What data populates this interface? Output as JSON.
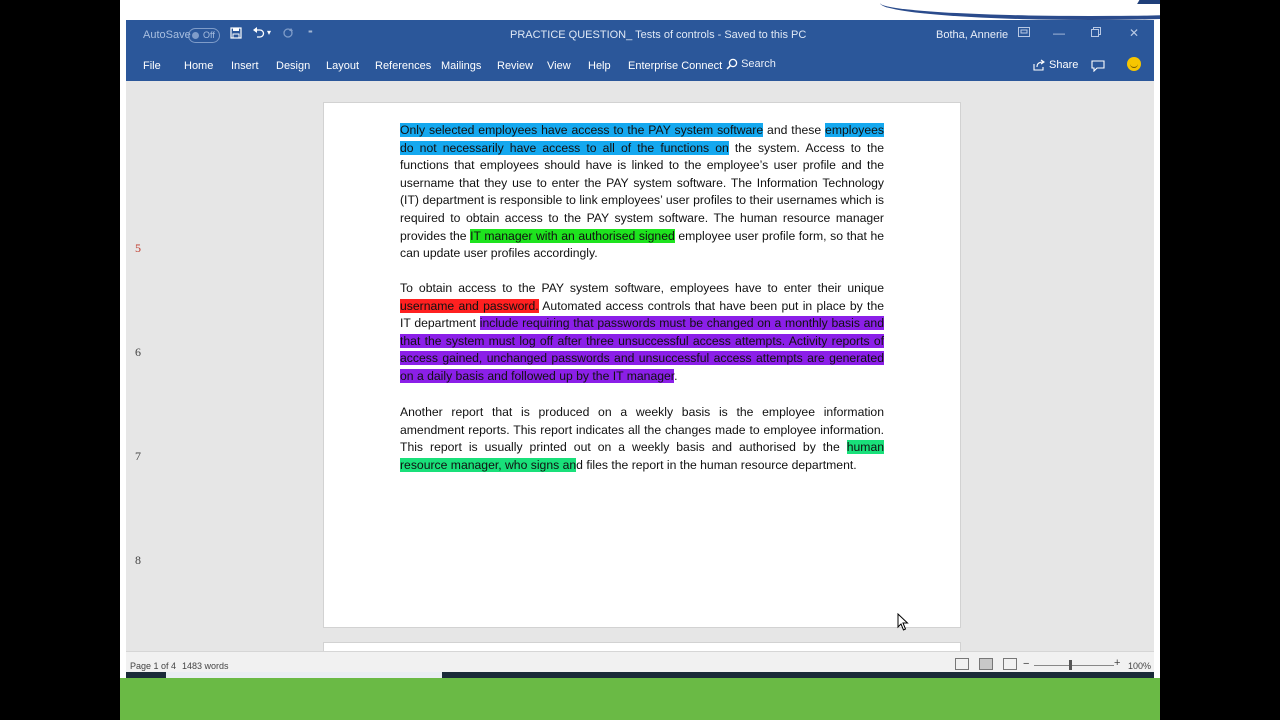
{
  "titlebar": {
    "autosave_label": "AutoSave",
    "autosave_state": "Off",
    "document_title": "PRACTICE QUESTION_ Tests of controls  -  Saved to this PC",
    "user_name": "Botha, Annerie"
  },
  "ribbon": {
    "tabs": [
      "File",
      "Home",
      "Insert",
      "Design",
      "Layout",
      "References",
      "Mailings",
      "Review",
      "View",
      "Help",
      "Enterprise Connect"
    ],
    "search_label": "Search",
    "share_label": "Share"
  },
  "margin_numbers": [
    "5",
    "6",
    "7",
    "8"
  ],
  "document": {
    "p1": {
      "s1": "Only selected employees have access to the PAY system software",
      "s2": " and these ",
      "s3": "employees do not necessarily have access to all of the functions on",
      "s4": " the system. Access to the functions that employees should have is linked to the employee’s user profile and the username that they use to enter the PAY system software. The Information Technology (IT) department is responsible to link employees’ user profiles to their usernames which is required to obtain access to the PAY system software. The human resource manager provides the ",
      "s5": "IT manager with an authorised signed",
      "s6": " employee user profile form, so that he can update user profiles accordingly."
    },
    "p2": {
      "s1": "To obtain access to the PAY system software, employees have to enter their unique ",
      "s2": "username and password.",
      "s3": " Automated access controls that have been put in place by the IT department ",
      "s4": "include requiring that passwords must be changed on a monthly basis and that the system must log off after three unsuccessful access attempts. Activity reports of access gained, unchanged passwords and unsuccessful access attempts are generated on a daily basis and followed up by the IT manager",
      "s5": "."
    },
    "p3": {
      "s1": "Another report that is produced on a weekly basis is the employee information amendment reports. This report indicates all the changes made to employee information. This report is usually printed out on a weekly basis and authorised by the ",
      "s2": "human resource manager, who signs an",
      "s3": "d files the report in the human resource department."
    }
  },
  "statusbar": {
    "page": "Page 1 of 4",
    "words": "1483 words",
    "zoom": "100%"
  },
  "colors": {
    "word_blue": "#2b579a",
    "highlight_blue": "#14a8ef",
    "highlight_green": "#1ee31e",
    "highlight_red": "#ff2020",
    "highlight_purple": "#8b1fe8",
    "highlight_teal": "#19e07a",
    "slide_green": "#6aba45"
  }
}
